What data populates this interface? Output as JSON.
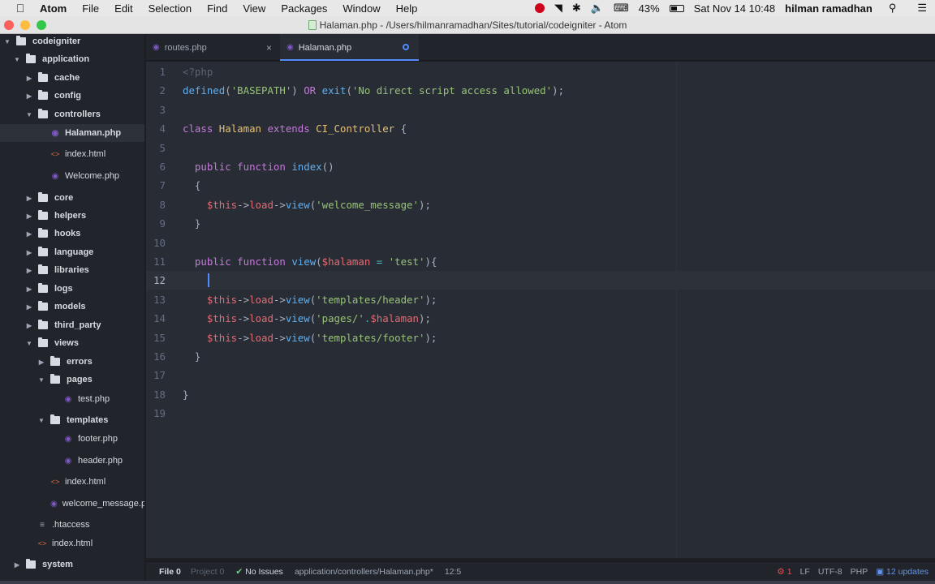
{
  "menubar": {
    "items": [
      "Atom",
      "File",
      "Edit",
      "Selection",
      "Find",
      "View",
      "Packages",
      "Window",
      "Help"
    ],
    "battery": "43%",
    "datetime": "Sat Nov 14  10:48",
    "user": "hilman ramadhan"
  },
  "window": {
    "title": "Halaman.php - /Users/hilmanramadhan/Sites/tutorial/codeigniter - Atom"
  },
  "tree": {
    "items": [
      {
        "label": "codeigniter",
        "type": "folder"
      },
      {
        "label": "application",
        "type": "folder"
      },
      {
        "label": "cache",
        "type": "folder"
      },
      {
        "label": "config",
        "type": "folder"
      },
      {
        "label": "controllers",
        "type": "folder"
      },
      {
        "label": "Halaman.php",
        "type": "php"
      },
      {
        "label": "index.html",
        "type": "html"
      },
      {
        "label": "Welcome.php",
        "type": "php"
      },
      {
        "label": "core",
        "type": "folder"
      },
      {
        "label": "helpers",
        "type": "folder"
      },
      {
        "label": "hooks",
        "type": "folder"
      },
      {
        "label": "language",
        "type": "folder"
      },
      {
        "label": "libraries",
        "type": "folder"
      },
      {
        "label": "logs",
        "type": "folder"
      },
      {
        "label": "models",
        "type": "folder"
      },
      {
        "label": "third_party",
        "type": "folder"
      },
      {
        "label": "views",
        "type": "folder"
      },
      {
        "label": "errors",
        "type": "folder"
      },
      {
        "label": "pages",
        "type": "folder"
      },
      {
        "label": "test.php",
        "type": "php"
      },
      {
        "label": "templates",
        "type": "folder"
      },
      {
        "label": "footer.php",
        "type": "php"
      },
      {
        "label": "header.php",
        "type": "php"
      },
      {
        "label": "index.html",
        "type": "html"
      },
      {
        "label": "welcome_message.p",
        "type": "php"
      },
      {
        "label": ".htaccess",
        "type": "txt"
      },
      {
        "label": "index.html",
        "type": "html"
      },
      {
        "label": "system",
        "type": "folder"
      }
    ]
  },
  "tabs": [
    {
      "label": "routes.php",
      "active": false
    },
    {
      "label": "Halaman.php",
      "active": true,
      "modified": true
    }
  ],
  "editor": {
    "cursor_line": 12,
    "lines": [
      {
        "n": "1",
        "tokens": [
          [
            "g",
            "<?php"
          ]
        ]
      },
      {
        "n": "2",
        "tokens": [
          [
            "f",
            "defined"
          ],
          [
            "p",
            "("
          ],
          [
            "s",
            "'BASEPATH'"
          ],
          [
            "p",
            ") "
          ],
          [
            "k",
            "OR"
          ],
          [
            "p",
            " "
          ],
          [
            "f",
            "exit"
          ],
          [
            "p",
            "("
          ],
          [
            "s",
            "'No direct script access allowed'"
          ],
          [
            "p",
            ");"
          ]
        ]
      },
      {
        "n": "3",
        "tokens": []
      },
      {
        "n": "4",
        "tokens": [
          [
            "k",
            "class"
          ],
          [
            "p",
            " "
          ],
          [
            "c",
            "Halaman"
          ],
          [
            "p",
            " "
          ],
          [
            "k",
            "extends"
          ],
          [
            "p",
            " "
          ],
          [
            "c",
            "CI_Controller"
          ],
          [
            "p",
            " {"
          ]
        ]
      },
      {
        "n": "5",
        "tokens": []
      },
      {
        "n": "6",
        "tokens": [
          [
            "p",
            "  "
          ],
          [
            "k",
            "public"
          ],
          [
            "p",
            " "
          ],
          [
            "k",
            "function"
          ],
          [
            "p",
            " "
          ],
          [
            "f",
            "index"
          ],
          [
            "p",
            "()"
          ]
        ]
      },
      {
        "n": "7",
        "tokens": [
          [
            "p",
            "  {"
          ]
        ]
      },
      {
        "n": "8",
        "tokens": [
          [
            "p",
            "    "
          ],
          [
            "v",
            "$this"
          ],
          [
            "p",
            "->"
          ],
          [
            "v",
            "load"
          ],
          [
            "p",
            "->"
          ],
          [
            "f",
            "view"
          ],
          [
            "p",
            "("
          ],
          [
            "s",
            "'welcome_message'"
          ],
          [
            "p",
            ");"
          ]
        ]
      },
      {
        "n": "9",
        "tokens": [
          [
            "p",
            "  }"
          ]
        ]
      },
      {
        "n": "10",
        "tokens": []
      },
      {
        "n": "11",
        "tokens": [
          [
            "p",
            "  "
          ],
          [
            "k",
            "public"
          ],
          [
            "p",
            " "
          ],
          [
            "k",
            "function"
          ],
          [
            "p",
            " "
          ],
          [
            "f",
            "view"
          ],
          [
            "p",
            "("
          ],
          [
            "v",
            "$halaman"
          ],
          [
            "p",
            " "
          ],
          [
            "o",
            "="
          ],
          [
            "p",
            " "
          ],
          [
            "s",
            "'test'"
          ],
          [
            "p",
            "){"
          ]
        ]
      },
      {
        "n": "12",
        "tokens": []
      },
      {
        "n": "13",
        "tokens": [
          [
            "p",
            "    "
          ],
          [
            "v",
            "$this"
          ],
          [
            "p",
            "->"
          ],
          [
            "v",
            "load"
          ],
          [
            "p",
            "->"
          ],
          [
            "f",
            "view"
          ],
          [
            "p",
            "("
          ],
          [
            "s",
            "'templates/header'"
          ],
          [
            "p",
            ");"
          ]
        ]
      },
      {
        "n": "14",
        "tokens": [
          [
            "p",
            "    "
          ],
          [
            "v",
            "$this"
          ],
          [
            "p",
            "->"
          ],
          [
            "v",
            "load"
          ],
          [
            "p",
            "->"
          ],
          [
            "f",
            "view"
          ],
          [
            "p",
            "("
          ],
          [
            "s",
            "'pages/'"
          ],
          [
            "o",
            "."
          ],
          [
            "v",
            "$halaman"
          ],
          [
            "p",
            ");"
          ]
        ]
      },
      {
        "n": "15",
        "tokens": [
          [
            "p",
            "    "
          ],
          [
            "v",
            "$this"
          ],
          [
            "p",
            "->"
          ],
          [
            "v",
            "load"
          ],
          [
            "p",
            "->"
          ],
          [
            "f",
            "view"
          ],
          [
            "p",
            "("
          ],
          [
            "s",
            "'templates/footer'"
          ],
          [
            "p",
            ");"
          ]
        ]
      },
      {
        "n": "16",
        "tokens": [
          [
            "p",
            "  }"
          ]
        ]
      },
      {
        "n": "17",
        "tokens": []
      },
      {
        "n": "18",
        "tokens": [
          [
            "p",
            "}"
          ]
        ]
      },
      {
        "n": "19",
        "tokens": []
      }
    ]
  },
  "status": {
    "file_label": "File",
    "file_count": "0",
    "project_label": "Project",
    "project_count": "0",
    "issues": "No Issues",
    "path": "application/controllers/Halaman.php*",
    "position": "12:5",
    "bug_count": "1",
    "line_ending": "LF",
    "encoding": "UTF-8",
    "grammar": "PHP",
    "updates": "12 updates"
  }
}
